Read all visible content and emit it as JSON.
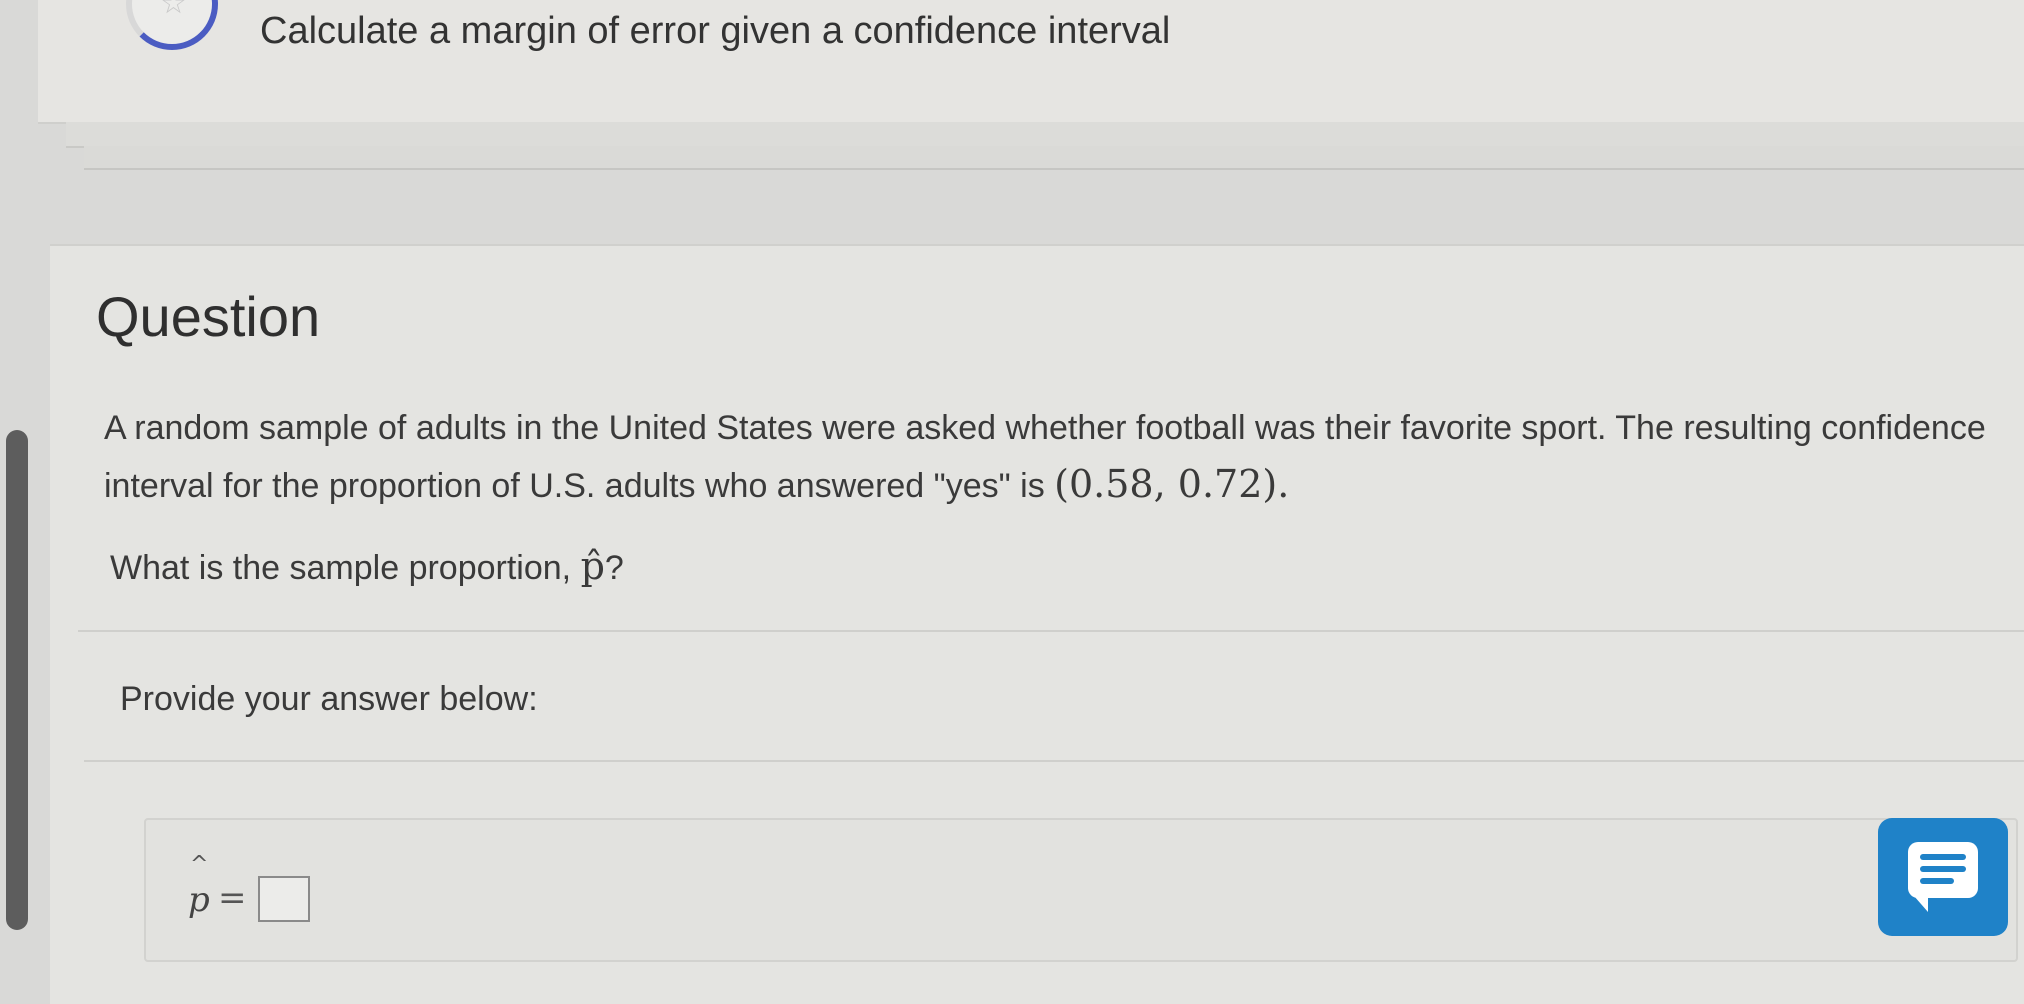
{
  "header": {
    "title": "Calculate a margin of error given a confidence interval",
    "icon": "star-progress-icon"
  },
  "question": {
    "heading": "Question",
    "text_part1": "A random sample of adults in the United States were asked whether football was their favorite sport. The resulting confidence interval for the proportion of U.S. adults who answered \"yes\" is ",
    "interval": "(0.58, 0.72)",
    "text_part2": ".",
    "ask_part1": "What is the sample proportion, ",
    "ask_symbol": "p̂",
    "ask_part2": "?"
  },
  "answer": {
    "label": "Provide your answer below:",
    "hat": "^",
    "variable": "p",
    "equals": "=",
    "value": ""
  },
  "chat": {
    "icon": "chat-message-icon",
    "color": "#1f82c8"
  }
}
